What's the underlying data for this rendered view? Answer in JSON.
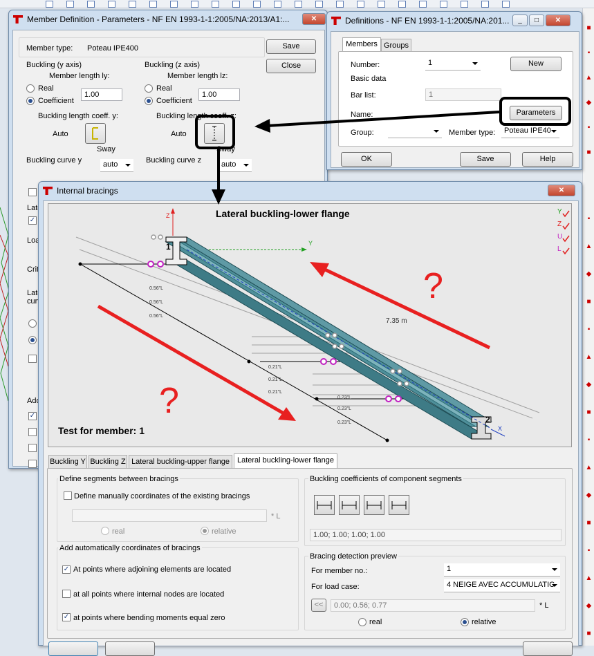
{
  "member_def": {
    "title": "Member Definition - Parameters - NF EN 1993-1-1:2005/NA:2013/A1:...",
    "member_type_label": "Member type:",
    "member_type_value": "Poteau IPE400",
    "save": "Save",
    "close": "Close",
    "buckling_y": {
      "title": "Buckling (y axis)",
      "length_label": "Member length ly:",
      "real": "Real",
      "coefficient": "Coefficient",
      "value": "1.00",
      "coeff_label": "Buckling length coeff. y:",
      "auto": "Auto",
      "sway": "Sway",
      "curve_label": "Buckling curve y",
      "curve_value": "auto"
    },
    "buckling_z": {
      "title": "Buckling (z axis)",
      "length_label": "Member length lz:",
      "real": "Real",
      "coefficient": "Coefficient",
      "value": "1.00",
      "coeff_label": "Buckling length coeff. z:",
      "auto": "Auto",
      "sway": "Sway",
      "curve_label": "Buckling curve z",
      "curve_value": "auto"
    },
    "left_fragments": [
      "Late",
      "Loa",
      "Criti",
      "Late",
      "curv",
      "Add"
    ]
  },
  "definitions": {
    "title": "Definitions - NF EN 1993-1-1:2005/NA:201...",
    "tabs": [
      "Members",
      "Groups"
    ],
    "number_label": "Number:",
    "number_value": "1",
    "new": "New",
    "basic_data": "Basic data",
    "bar_list_label": "Bar list:",
    "bar_list_value": "1",
    "name_label": "Name:",
    "parameters": "Parameters",
    "group_label": "Group:",
    "member_type_label": "Member type:",
    "member_type_value": "Poteau IPE40",
    "ok": "OK",
    "save": "Save",
    "help": "Help"
  },
  "bracings": {
    "title": "Internal bracings",
    "drawing": {
      "title": "Lateral buckling-lower flange",
      "length_label": "7.35  m",
      "test_label": "Test for member: 1",
      "node_start": "1",
      "node_end": "2",
      "axis_z": "Z",
      "axis_y": "Y",
      "axis_x": "X",
      "question": "?",
      "legend": [
        "Y",
        "Z",
        "U",
        "L"
      ],
      "dim_labels": [
        "0.56\"L",
        "0.56\"L",
        "0.56\"L",
        "0.21\"L",
        "0.21\"L",
        "0.21\"L",
        "0.23\"L",
        "0.23\"L",
        "0.23\"L"
      ],
      "colors": {
        "beam": "#4f8f9a",
        "arrow": "#e82020",
        "bracing": "#c020c0"
      }
    },
    "tabs": [
      "Buckling Y",
      "Buckling Z",
      "Lateral buckling-upper flange",
      "Lateral buckling-lower flange"
    ],
    "define_segments": {
      "title": "Define segments between bracings",
      "manual_label": "Define manually coordinates of the existing bracings",
      "unit": "* L",
      "real": "real",
      "relative": "relative"
    },
    "auto_coords": {
      "title": "Add automatically coordinates of bracings",
      "options": [
        "At points where adjoining elements are located",
        "at all points where internal nodes are located",
        "at points where bending moments equal zero"
      ],
      "checked": [
        true,
        false,
        true
      ]
    },
    "coefficients": {
      "title": "Buckling coefficients of component segments",
      "value": "1.00; 1.00; 1.00; 1.00"
    },
    "preview": {
      "title": "Bracing detection preview",
      "member_label": "For member no.:",
      "member_value": "1",
      "load_label": "For load case:",
      "load_value": "4  NEIGE AVEC ACCUMULATIC",
      "back": "<<",
      "coords": "0.00; 0.56; 0.77",
      "unit": "* L",
      "real": "real",
      "relative": "relative"
    }
  }
}
